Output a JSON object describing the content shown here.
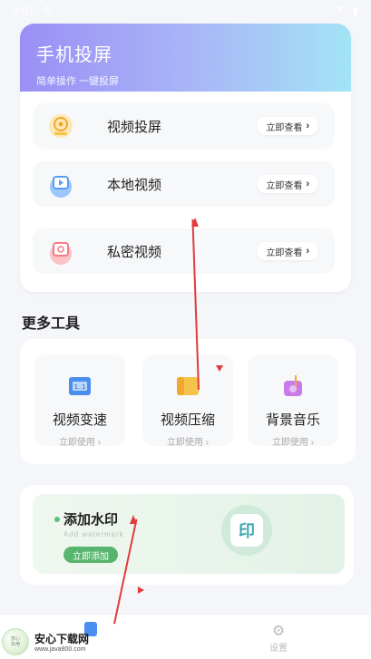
{
  "status_bar": {
    "time": "5:01"
  },
  "hero": {
    "title": "手机投屏",
    "subtitle": "简单操作  一键投屏",
    "gradient": [
      "#9b8ff5",
      "#a3e4f5"
    ]
  },
  "features": [
    {
      "label": "视频投屏",
      "button": "立即查看",
      "icon": "cast-icon",
      "color": "#f5c24a"
    },
    {
      "label": "本地视频",
      "button": "立即查看",
      "icon": "folder-video-icon",
      "color": "#5a9df5"
    },
    {
      "label": "私密视频",
      "button": "立即查看",
      "icon": "private-video-icon",
      "color": "#f57a86"
    }
  ],
  "more_tools": {
    "title": "更多工具",
    "items": [
      {
        "label": "视频变速",
        "sub": "立即使用 ›",
        "icon": "speed-icon",
        "color": "#4a8ff0"
      },
      {
        "label": "视频压缩",
        "sub": "立即使用 ›",
        "icon": "compress-icon",
        "color": "#f5b842"
      },
      {
        "label": "背景音乐",
        "sub": "立即使用 ›",
        "icon": "music-icon",
        "color": "#c77ae8"
      }
    ]
  },
  "watermark": {
    "title": "添加水印",
    "subtitle": "Add watermark",
    "button": "立即添加",
    "icon_char": "印"
  },
  "bottom_nav": {
    "settings": "设置"
  },
  "overlay_logo": {
    "name": "安心下载网",
    "url": "www.java800.com",
    "heart_text": "放心\n实用"
  }
}
